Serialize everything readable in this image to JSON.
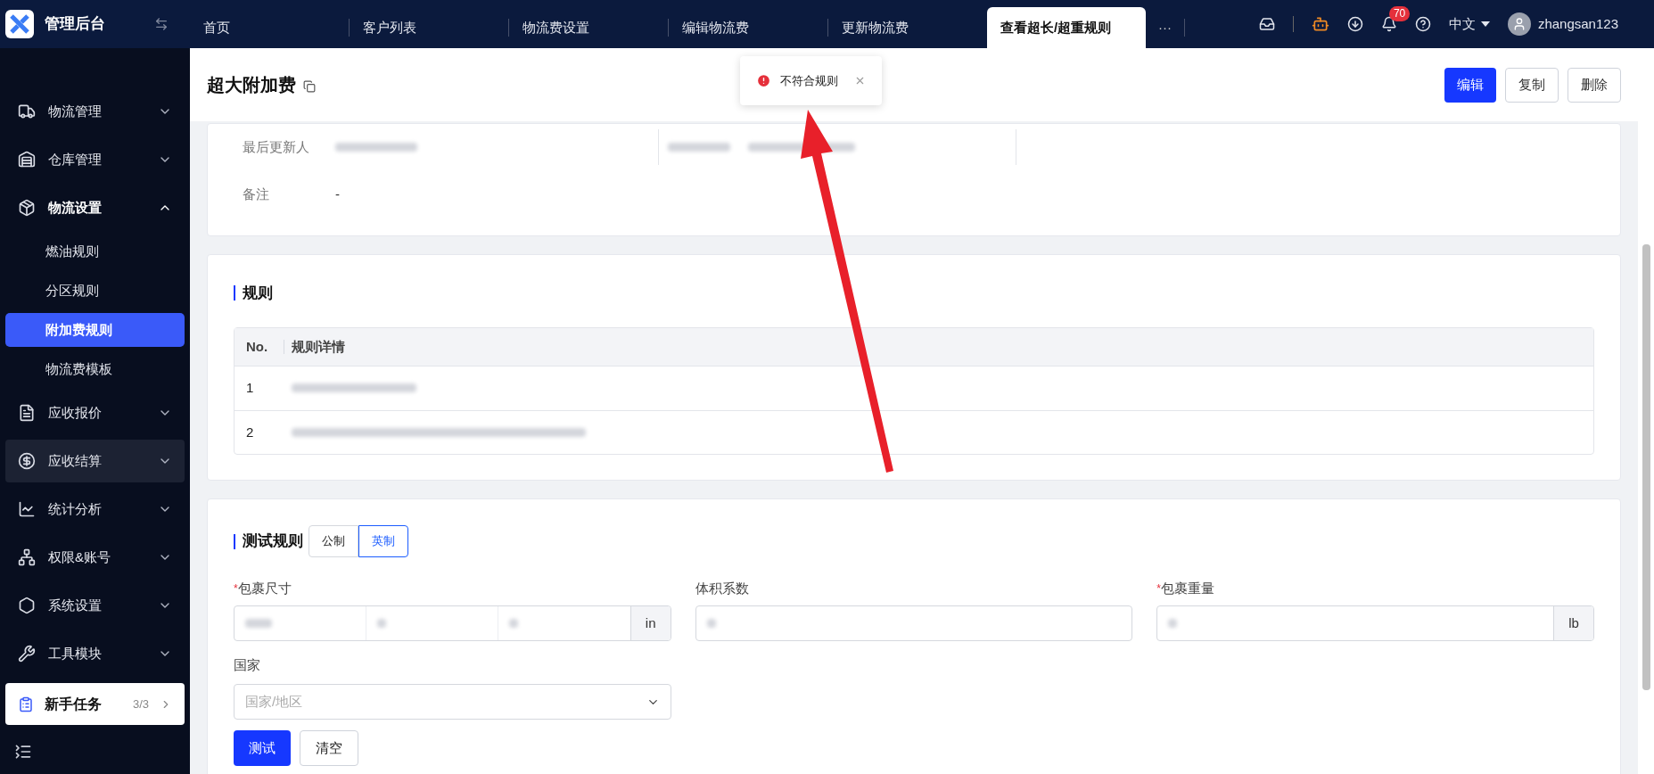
{
  "brand": {
    "title": "管理后台"
  },
  "tabs": [
    {
      "label": "首页",
      "selected": false
    },
    {
      "label": "客户列表",
      "selected": false
    },
    {
      "label": "物流费设置",
      "selected": false
    },
    {
      "label": "编辑物流费",
      "selected": false
    },
    {
      "label": "更新物流费",
      "selected": false
    },
    {
      "label": "查看超长/超重规则",
      "selected": true
    }
  ],
  "tabs_more": "···",
  "topbar": {
    "notification_count": "70",
    "language": "中文",
    "username": "zhangsan123"
  },
  "sidebar": {
    "items": [
      {
        "label": "物流管理",
        "expanded": false,
        "selected": false,
        "highlighted": false
      },
      {
        "label": "仓库管理",
        "expanded": false,
        "selected": false,
        "highlighted": false
      },
      {
        "label": "物流设置",
        "expanded": true,
        "selected": false,
        "highlighted": false,
        "children": [
          {
            "label": "燃油规则",
            "selected": false
          },
          {
            "label": "分区规则",
            "selected": false
          },
          {
            "label": "附加费规则",
            "selected": true
          },
          {
            "label": "物流费模板",
            "selected": false
          }
        ]
      },
      {
        "label": "应收报价",
        "expanded": false,
        "selected": false,
        "highlighted": false
      },
      {
        "label": "应收结算",
        "expanded": false,
        "selected": false,
        "highlighted": true
      },
      {
        "label": "统计分析",
        "expanded": false,
        "selected": false,
        "highlighted": false
      },
      {
        "label": "权限&账号",
        "expanded": false,
        "selected": false,
        "highlighted": false
      },
      {
        "label": "系统设置",
        "expanded": false,
        "selected": false,
        "highlighted": false
      },
      {
        "label": "工具模块",
        "expanded": false,
        "selected": false,
        "highlighted": false
      }
    ],
    "task": {
      "label": "新手任务",
      "progress": "3/3"
    }
  },
  "page": {
    "title": "超大附加费",
    "actions": [
      {
        "label": "编辑",
        "primary": true
      },
      {
        "label": "复制",
        "primary": false
      },
      {
        "label": "删除",
        "primary": false
      }
    ]
  },
  "toast": {
    "message": "不符合规则"
  },
  "info": {
    "fields": [
      {
        "label": "最后更新人"
      },
      {
        "label": "备注",
        "value": "-"
      }
    ]
  },
  "rules": {
    "title": "规则",
    "columns": [
      "No.",
      "规则详情"
    ],
    "rows": [
      {
        "no": "1"
      },
      {
        "no": "2"
      }
    ]
  },
  "test": {
    "title": "测试规则",
    "units": [
      {
        "label": "公制",
        "selected": false
      },
      {
        "label": "英制",
        "selected": true
      }
    ],
    "fields": [
      {
        "kind": "dimensions",
        "label": "包裹尺寸",
        "required_mark": "*",
        "unit": "in"
      },
      {
        "kind": "text",
        "label": "体积系数"
      },
      {
        "kind": "unit",
        "label": "包裹重量",
        "required_mark": "*",
        "unit": "lb"
      }
    ],
    "country": {
      "label": "国家",
      "placeholder": "国家/地区"
    },
    "buttons": [
      {
        "label": "测试",
        "primary": true
      },
      {
        "label": "清空",
        "primary": false
      }
    ]
  }
}
